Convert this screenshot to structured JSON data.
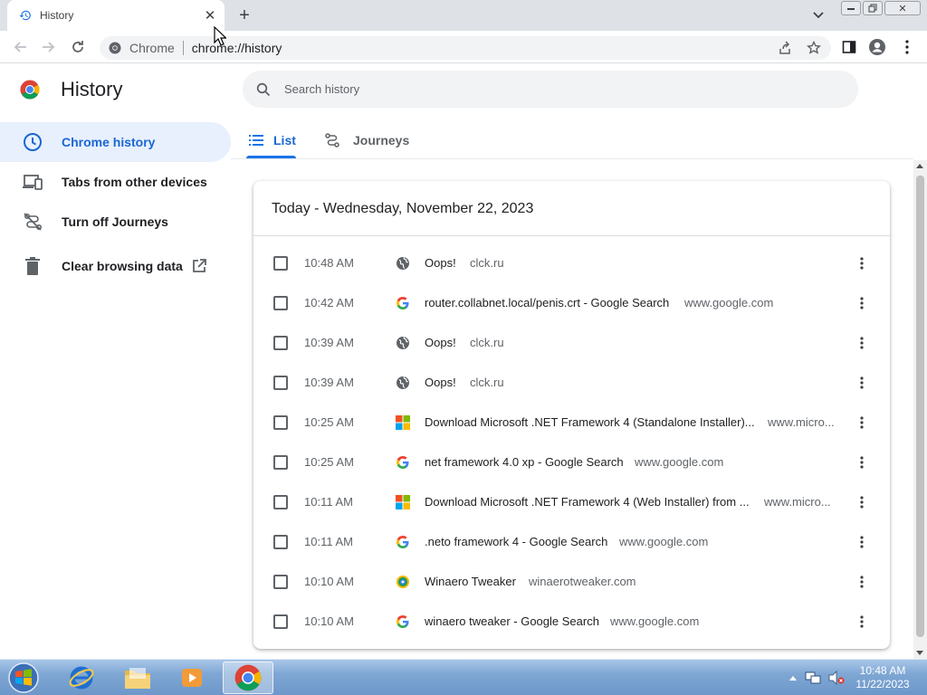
{
  "browser": {
    "tab_title": "History",
    "omnibox_chip": "Chrome",
    "omnibox_url": "chrome://history"
  },
  "page": {
    "title": "History",
    "search_placeholder": "Search history"
  },
  "sidebar": {
    "items": [
      {
        "label": "Chrome history"
      },
      {
        "label": "Tabs from other devices"
      },
      {
        "label": "Turn off Journeys"
      },
      {
        "label": "Clear browsing data"
      }
    ]
  },
  "tabs": {
    "list": "List",
    "journeys": "Journeys"
  },
  "history": {
    "date_heading": "Today - Wednesday, November 22, 2023",
    "entries": [
      {
        "time": "10:48 AM",
        "icon": "globe-icon",
        "title": "Oops!",
        "domain": "clck.ru"
      },
      {
        "time": "10:42 AM",
        "icon": "google-icon",
        "title": "router.collabnet.local/penis.crt - Google Search",
        "domain": "www.google.com"
      },
      {
        "time": "10:39 AM",
        "icon": "globe-icon",
        "title": "Oops!",
        "domain": "clck.ru"
      },
      {
        "time": "10:39 AM",
        "icon": "globe-icon",
        "title": "Oops!",
        "domain": "clck.ru"
      },
      {
        "time": "10:25 AM",
        "icon": "microsoft-icon",
        "title": "Download Microsoft .NET Framework 4 (Standalone Installer)...",
        "domain": "www.micro..."
      },
      {
        "time": "10:25 AM",
        "icon": "google-icon",
        "title": "net framework 4.0 xp - Google Search",
        "domain": "www.google.com"
      },
      {
        "time": "10:11 AM",
        "icon": "microsoft-icon",
        "title": "Download Microsoft .NET Framework 4 (Web Installer) from ...",
        "domain": "www.micro..."
      },
      {
        "time": "10:11 AM",
        "icon": "google-icon",
        "title": ".neto framework 4 - Google Search",
        "domain": "www.google.com"
      },
      {
        "time": "10:10 AM",
        "icon": "winaero-icon",
        "title": "Winaero Tweaker",
        "domain": "winaerotweaker.com"
      },
      {
        "time": "10:10 AM",
        "icon": "google-icon",
        "title": "winaero tweaker - Google Search",
        "domain": "www.google.com"
      }
    ]
  },
  "taskbar": {
    "time": "10:48 AM",
    "date": "11/22/2023"
  },
  "colors": {
    "accent": "#1a73e8",
    "selected_bg": "#e8f0fe",
    "taskbar": "#7fa7d4"
  }
}
